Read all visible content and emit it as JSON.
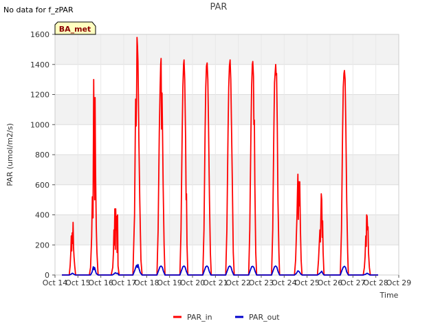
{
  "page": {
    "note": "No data for f_zPAR",
    "badge": "BA_met"
  },
  "chart_data": {
    "type": "line",
    "title": "PAR",
    "xlabel": "Time",
    "ylabel": "PAR (umol/m2/s)",
    "xlim": [
      14,
      29
    ],
    "ylim": [
      0,
      1600
    ],
    "x_ticks": [
      14,
      15,
      16,
      17,
      18,
      19,
      20,
      21,
      22,
      23,
      24,
      25,
      26,
      27,
      28,
      29
    ],
    "x_tick_labels": [
      "Oct 14",
      "Oct 15",
      "Oct 16",
      "Oct 17",
      "Oct 18",
      "Oct 19",
      "Oct 20",
      "Oct 21",
      "Oct 22",
      "Oct 23",
      "Oct 24",
      "Oct 25",
      "Oct 26",
      "Oct 27",
      "Oct 28",
      "Oct 29"
    ],
    "y_ticks": [
      0,
      200,
      400,
      600,
      800,
      1000,
      1200,
      1400,
      1600
    ],
    "grid": true,
    "legend_position": "bottom-center",
    "series": [
      {
        "name": "PAR_in",
        "color": "#ff0000",
        "points": [
          [
            14.3,
            0
          ],
          [
            14.62,
            0
          ],
          [
            14.66,
            60
          ],
          [
            14.69,
            150
          ],
          [
            14.71,
            260
          ],
          [
            14.73,
            160
          ],
          [
            14.75,
            280
          ],
          [
            14.77,
            210
          ],
          [
            14.79,
            350
          ],
          [
            14.81,
            180
          ],
          [
            14.83,
            120
          ],
          [
            14.86,
            60
          ],
          [
            14.9,
            0
          ],
          [
            15.5,
            0
          ],
          [
            15.55,
            50
          ],
          [
            15.6,
            250
          ],
          [
            15.63,
            520
          ],
          [
            15.66,
            380
          ],
          [
            15.69,
            1300
          ],
          [
            15.71,
            800
          ],
          [
            15.73,
            500
          ],
          [
            15.75,
            1180
          ],
          [
            15.77,
            700
          ],
          [
            15.8,
            330
          ],
          [
            15.83,
            150
          ],
          [
            15.88,
            0
          ],
          [
            16.45,
            0
          ],
          [
            16.52,
            50
          ],
          [
            16.55,
            150
          ],
          [
            16.57,
            300
          ],
          [
            16.59,
            200
          ],
          [
            16.61,
            440
          ],
          [
            16.63,
            170
          ],
          [
            16.65,
            440
          ],
          [
            16.67,
            300
          ],
          [
            16.69,
            390
          ],
          [
            16.71,
            150
          ],
          [
            16.73,
            400
          ],
          [
            16.75,
            60
          ],
          [
            16.8,
            0
          ],
          [
            17.4,
            0
          ],
          [
            17.47,
            400
          ],
          [
            17.5,
            900
          ],
          [
            17.52,
            1170
          ],
          [
            17.54,
            990
          ],
          [
            17.56,
            1200
          ],
          [
            17.58,
            1580
          ],
          [
            17.6,
            1520
          ],
          [
            17.62,
            1420
          ],
          [
            17.64,
            1200
          ],
          [
            17.66,
            900
          ],
          [
            17.7,
            500
          ],
          [
            17.75,
            100
          ],
          [
            17.8,
            0
          ],
          [
            18.45,
            0
          ],
          [
            18.5,
            300
          ],
          [
            18.55,
            950
          ],
          [
            18.58,
            1200
          ],
          [
            18.61,
            1400
          ],
          [
            18.63,
            1440
          ],
          [
            18.65,
            970
          ],
          [
            18.67,
            1210
          ],
          [
            18.69,
            1000
          ],
          [
            18.72,
            600
          ],
          [
            18.76,
            200
          ],
          [
            18.8,
            0
          ],
          [
            19.45,
            0
          ],
          [
            19.5,
            300
          ],
          [
            19.55,
            950
          ],
          [
            19.58,
            1250
          ],
          [
            19.61,
            1400
          ],
          [
            19.63,
            1430
          ],
          [
            19.66,
            1300
          ],
          [
            19.7,
            900
          ],
          [
            19.72,
            500
          ],
          [
            19.74,
            540
          ],
          [
            19.76,
            200
          ],
          [
            19.8,
            0
          ],
          [
            20.45,
            0
          ],
          [
            20.5,
            300
          ],
          [
            20.55,
            950
          ],
          [
            20.58,
            1250
          ],
          [
            20.61,
            1390
          ],
          [
            20.64,
            1410
          ],
          [
            20.67,
            1300
          ],
          [
            20.7,
            1000
          ],
          [
            20.74,
            500
          ],
          [
            20.78,
            150
          ],
          [
            20.82,
            0
          ],
          [
            21.45,
            0
          ],
          [
            21.5,
            300
          ],
          [
            21.55,
            950
          ],
          [
            21.58,
            1250
          ],
          [
            21.61,
            1390
          ],
          [
            21.64,
            1430
          ],
          [
            21.67,
            1300
          ],
          [
            21.7,
            1000
          ],
          [
            21.74,
            600
          ],
          [
            21.78,
            150
          ],
          [
            21.82,
            0
          ],
          [
            22.45,
            0
          ],
          [
            22.5,
            300
          ],
          [
            22.55,
            950
          ],
          [
            22.58,
            1250
          ],
          [
            22.61,
            1400
          ],
          [
            22.63,
            1420
          ],
          [
            22.66,
            1320
          ],
          [
            22.68,
            1000
          ],
          [
            22.7,
            1030
          ],
          [
            22.72,
            600
          ],
          [
            22.76,
            150
          ],
          [
            22.8,
            0
          ],
          [
            23.45,
            0
          ],
          [
            23.5,
            300
          ],
          [
            23.55,
            950
          ],
          [
            23.58,
            1280
          ],
          [
            23.61,
            1350
          ],
          [
            23.63,
            1400
          ],
          [
            23.65,
            1330
          ],
          [
            23.67,
            1340
          ],
          [
            23.7,
            1000
          ],
          [
            23.73,
            500
          ],
          [
            23.77,
            150
          ],
          [
            23.8,
            0
          ],
          [
            24.45,
            0
          ],
          [
            24.5,
            100
          ],
          [
            24.53,
            250
          ],
          [
            24.56,
            400
          ],
          [
            24.58,
            560
          ],
          [
            24.6,
            670
          ],
          [
            24.62,
            370
          ],
          [
            24.64,
            620
          ],
          [
            24.66,
            460
          ],
          [
            24.68,
            620
          ],
          [
            24.71,
            300
          ],
          [
            24.74,
            100
          ],
          [
            24.78,
            0
          ],
          [
            25.45,
            0
          ],
          [
            25.5,
            100
          ],
          [
            25.53,
            200
          ],
          [
            25.56,
            300
          ],
          [
            25.58,
            220
          ],
          [
            25.6,
            380
          ],
          [
            25.62,
            540
          ],
          [
            25.64,
            500
          ],
          [
            25.66,
            250
          ],
          [
            25.68,
            360
          ],
          [
            25.7,
            150
          ],
          [
            25.74,
            0
          ],
          [
            26.45,
            0
          ],
          [
            26.5,
            300
          ],
          [
            26.55,
            950
          ],
          [
            26.58,
            1250
          ],
          [
            26.61,
            1340
          ],
          [
            26.63,
            1360
          ],
          [
            26.66,
            1300
          ],
          [
            26.69,
            1000
          ],
          [
            26.73,
            500
          ],
          [
            26.77,
            150
          ],
          [
            26.8,
            0
          ],
          [
            27.45,
            0
          ],
          [
            27.5,
            50
          ],
          [
            27.53,
            120
          ],
          [
            27.56,
            260
          ],
          [
            27.58,
            190
          ],
          [
            27.6,
            400
          ],
          [
            27.62,
            390
          ],
          [
            27.64,
            300
          ],
          [
            27.66,
            320
          ],
          [
            27.68,
            150
          ],
          [
            27.72,
            50
          ],
          [
            27.76,
            0
          ],
          [
            28.1,
            0
          ]
        ]
      },
      {
        "name": "PAR_out",
        "color": "#0000cc",
        "points": [
          [
            14.3,
            0
          ],
          [
            14.62,
            0
          ],
          [
            14.7,
            5
          ],
          [
            14.76,
            12
          ],
          [
            14.8,
            8
          ],
          [
            14.86,
            2
          ],
          [
            14.9,
            0
          ],
          [
            15.55,
            0
          ],
          [
            15.62,
            20
          ],
          [
            15.67,
            55
          ],
          [
            15.7,
            35
          ],
          [
            15.73,
            50
          ],
          [
            15.76,
            30
          ],
          [
            15.8,
            10
          ],
          [
            15.88,
            0
          ],
          [
            16.5,
            0
          ],
          [
            16.58,
            8
          ],
          [
            16.63,
            15
          ],
          [
            16.68,
            10
          ],
          [
            16.73,
            12
          ],
          [
            16.78,
            0
          ],
          [
            17.4,
            0
          ],
          [
            17.48,
            30
          ],
          [
            17.53,
            55
          ],
          [
            17.56,
            65
          ],
          [
            17.59,
            50
          ],
          [
            17.62,
            70
          ],
          [
            17.66,
            45
          ],
          [
            17.72,
            15
          ],
          [
            17.8,
            0
          ],
          [
            18.45,
            0
          ],
          [
            18.52,
            30
          ],
          [
            18.58,
            55
          ],
          [
            18.63,
            60
          ],
          [
            18.68,
            52
          ],
          [
            18.73,
            25
          ],
          [
            18.8,
            0
          ],
          [
            19.45,
            0
          ],
          [
            19.52,
            30
          ],
          [
            19.58,
            55
          ],
          [
            19.63,
            60
          ],
          [
            19.68,
            52
          ],
          [
            19.73,
            25
          ],
          [
            19.8,
            0
          ],
          [
            20.45,
            0
          ],
          [
            20.52,
            30
          ],
          [
            20.58,
            55
          ],
          [
            20.63,
            60
          ],
          [
            20.68,
            52
          ],
          [
            20.73,
            25
          ],
          [
            20.8,
            0
          ],
          [
            21.45,
            0
          ],
          [
            21.52,
            30
          ],
          [
            21.58,
            55
          ],
          [
            21.63,
            60
          ],
          [
            21.68,
            52
          ],
          [
            21.73,
            25
          ],
          [
            21.8,
            0
          ],
          [
            22.45,
            0
          ],
          [
            22.52,
            30
          ],
          [
            22.58,
            55
          ],
          [
            22.63,
            58
          ],
          [
            22.68,
            50
          ],
          [
            22.73,
            25
          ],
          [
            22.8,
            0
          ],
          [
            23.45,
            0
          ],
          [
            23.52,
            30
          ],
          [
            23.58,
            55
          ],
          [
            23.63,
            60
          ],
          [
            23.68,
            52
          ],
          [
            23.73,
            25
          ],
          [
            23.8,
            0
          ],
          [
            24.45,
            0
          ],
          [
            24.53,
            10
          ],
          [
            24.6,
            28
          ],
          [
            24.66,
            22
          ],
          [
            24.72,
            8
          ],
          [
            24.78,
            0
          ],
          [
            25.45,
            0
          ],
          [
            25.53,
            8
          ],
          [
            25.6,
            18
          ],
          [
            25.64,
            25
          ],
          [
            25.68,
            12
          ],
          [
            25.74,
            0
          ],
          [
            26.45,
            0
          ],
          [
            26.52,
            30
          ],
          [
            26.58,
            52
          ],
          [
            26.63,
            58
          ],
          [
            26.68,
            50
          ],
          [
            26.73,
            20
          ],
          [
            26.8,
            0
          ],
          [
            27.45,
            0
          ],
          [
            27.55,
            5
          ],
          [
            27.62,
            12
          ],
          [
            27.67,
            8
          ],
          [
            27.74,
            0
          ],
          [
            28.1,
            0
          ]
        ]
      }
    ]
  }
}
